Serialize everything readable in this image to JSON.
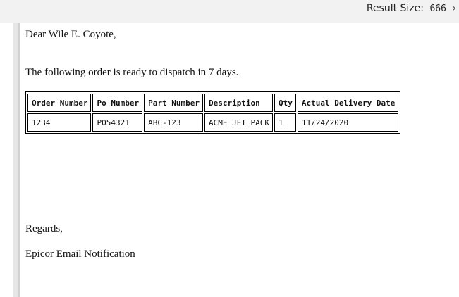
{
  "header": {
    "result_size_label": "Result Size:",
    "result_size_value": "666",
    "arrow": "›"
  },
  "email": {
    "greeting": "Dear Wile E. Coyote,",
    "intro": "The following order is ready to dispatch in 7 days.",
    "table": {
      "headers": [
        "Order Number",
        "Po Number",
        "Part Number",
        "Description",
        "Qty",
        "Actual Delivery Date"
      ],
      "rows": [
        [
          "1234",
          "PO54321",
          "ABC-123",
          "ACME JET PACK",
          "1",
          "11/24/2020"
        ]
      ]
    },
    "regards": "Regards,",
    "signature": "Epicor Email Notification"
  }
}
